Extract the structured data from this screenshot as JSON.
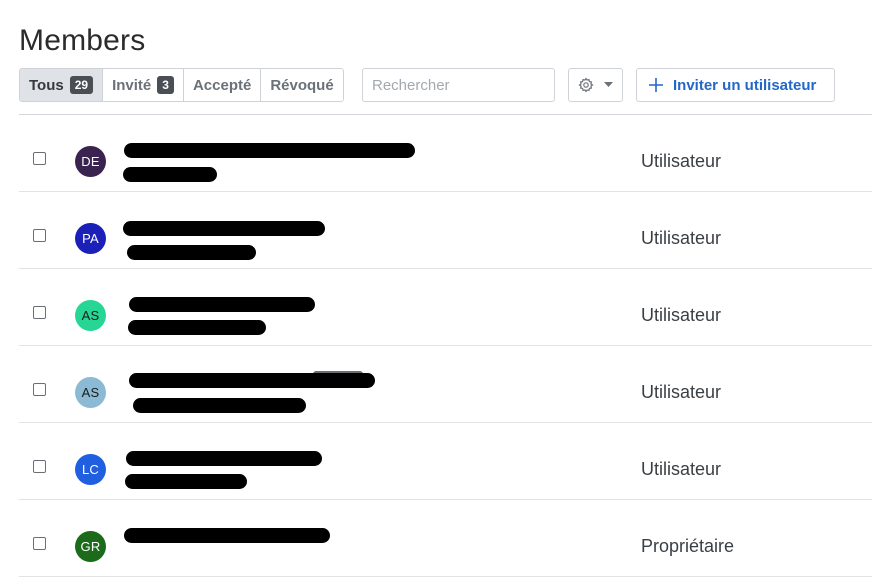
{
  "page": {
    "title": "Members"
  },
  "filters": [
    {
      "label": "Tous",
      "count": "29",
      "active": true
    },
    {
      "label": "Invité",
      "count": "3",
      "active": false
    },
    {
      "label": "Accepté",
      "count": null,
      "active": false
    },
    {
      "label": "Révoqué",
      "count": null,
      "active": false
    }
  ],
  "search": {
    "placeholder": "Rechercher",
    "value": ""
  },
  "settings": {
    "icon": "gear-icon",
    "caret_icon": "caret-down-icon"
  },
  "invite": {
    "label": "Inviter un utilisateur",
    "icon": "plus-icon"
  },
  "colors": {
    "accent": "#2367c9",
    "active_tab_bg": "#dfe2e6",
    "badge_bg": "#4a4f55"
  },
  "members": [
    {
      "initials": "DE",
      "avatar_color": "#3b2350",
      "avatar_text_color": "#ffffff",
      "role": "Utilisateur"
    },
    {
      "initials": "PA",
      "avatar_color": "#1b20b8",
      "avatar_text_color": "#ffffff",
      "role": "Utilisateur"
    },
    {
      "initials": "AS",
      "avatar_color": "#27d695",
      "avatar_text_color": "#1a1a1a",
      "role": "Utilisateur"
    },
    {
      "initials": "AS",
      "avatar_color": "#8cbad4",
      "avatar_text_color": "#1a1a1a",
      "role": "Utilisateur"
    },
    {
      "initials": "LC",
      "avatar_color": "#1f5fe0",
      "avatar_text_color": "#ffffff",
      "role": "Utilisateur"
    },
    {
      "initials": "GR",
      "avatar_color": "#1b6b1b",
      "avatar_text_color": "#ffffff",
      "role": "Propriétaire"
    }
  ]
}
